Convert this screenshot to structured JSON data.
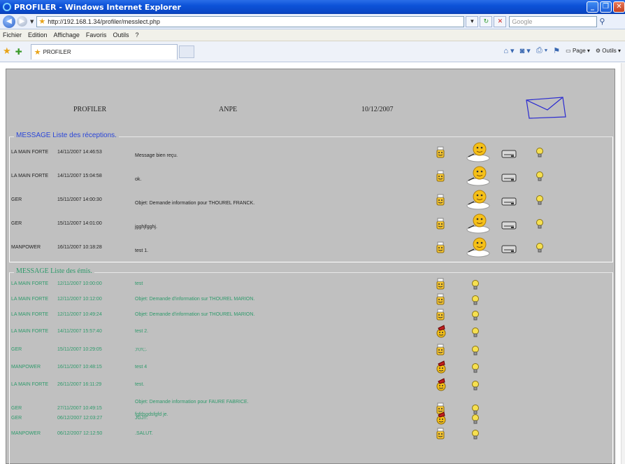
{
  "window": {
    "title": "PROFILER - Windows Internet Explorer",
    "url": "http://192.168.1.34/profiler/messlect.php",
    "search_placeholder": "Google",
    "tab_title": "PROFILER",
    "menu": [
      "Fichier",
      "Edition",
      "Affichage",
      "Favoris",
      "Outils",
      "?"
    ],
    "cmd": {
      "page": "Page",
      "tools": "Outils"
    }
  },
  "header": {
    "app": "PROFILER",
    "user": "ANPE",
    "date": "10/12/2007"
  },
  "reception": {
    "legend": "MESSAGE Liste des réceptions.",
    "rows": [
      {
        "from": "LA MAIN FORTE",
        "date": "14/11/2007 14:46:53",
        "subject": "Message bien reçu."
      },
      {
        "from": "LA MAIN FORTE",
        "date": "14/11/2007 15:04:58",
        "subject": "ok."
      },
      {
        "from": "GER",
        "date": "15/11/2007 14:00:30",
        "subject": "Objet: Demande information pour THOUREL FRANCK."
      },
      {
        "from": "GER",
        "date": "15/11/2007 14:01:00",
        "subject": "jgghjfgghj."
      },
      {
        "from": "MANPOWER",
        "date": "16/11/2007 10:18:28",
        "subject": "test 1."
      }
    ]
  },
  "emis": {
    "legend": "MESSAGE Liste des émis.",
    "rows": [
      {
        "to": "LA MAIN FORTE",
        "date": "12/11/2007 10:00:00",
        "subject": "test",
        "subject2": "",
        "icon": "read"
      },
      {
        "to": "LA MAIN FORTE",
        "date": "12/11/2007 10:12:00",
        "subject": "Objet: Demande d'information sur THOUREL MARION.",
        "subject2": "",
        "icon": "read"
      },
      {
        "to": "LA MAIN FORTE",
        "date": "12/11/2007 10:49:24",
        "subject": "Objet: Demande d'information sur THOUREL MARION.",
        "subject2": "",
        "icon": "read"
      },
      {
        "to": "LA MAIN FORTE",
        "date": "14/11/2007 15:57:40",
        "subject": "test 2.",
        "subject2": "",
        "icon": "unread"
      },
      {
        "to": "GER",
        "date": "15/11/2007 10:29:05",
        "subject": ";n;n;;.",
        "subject2": "",
        "icon": "read"
      },
      {
        "to": "MANPOWER",
        "date": "16/11/2007 10:48:15",
        "subject": "test 4",
        "subject2": "",
        "icon": "unread"
      },
      {
        "to": "LA MAIN FORTE",
        "date": "26/11/2007 16:11:29",
        "subject": "test.",
        "subject2": "",
        "icon": "unread"
      },
      {
        "to": "GER",
        "date": "27/11/2007 10:49:15",
        "subject": "Objet: Demande information pour FAURE FABRICE.",
        "subject2": "fgfdsgdsfgfd je.",
        "icon": "read"
      },
      {
        "to": "GER",
        "date": "06/12/2007 12:03:27",
        "subject": "JGJ!!.",
        "subject2": "",
        "icon": "unread"
      },
      {
        "to": "MANPOWER",
        "date": "06/12/2007 12:12:50",
        "subject": ".SALUT.",
        "subject2": "",
        "icon": "read"
      }
    ]
  },
  "colors": {
    "received_text": "#222222",
    "sent_text": "#2e9a6b",
    "legend_received": "#2a45d8",
    "page_bg": "#c0c0c0"
  },
  "icons": {
    "reception_row": [
      "reply-icon",
      "smiley-writing-icon",
      "printer-icon",
      "lightbulb-icon"
    ],
    "sent_row": [
      "status-icon",
      "lightbulb-icon"
    ]
  }
}
